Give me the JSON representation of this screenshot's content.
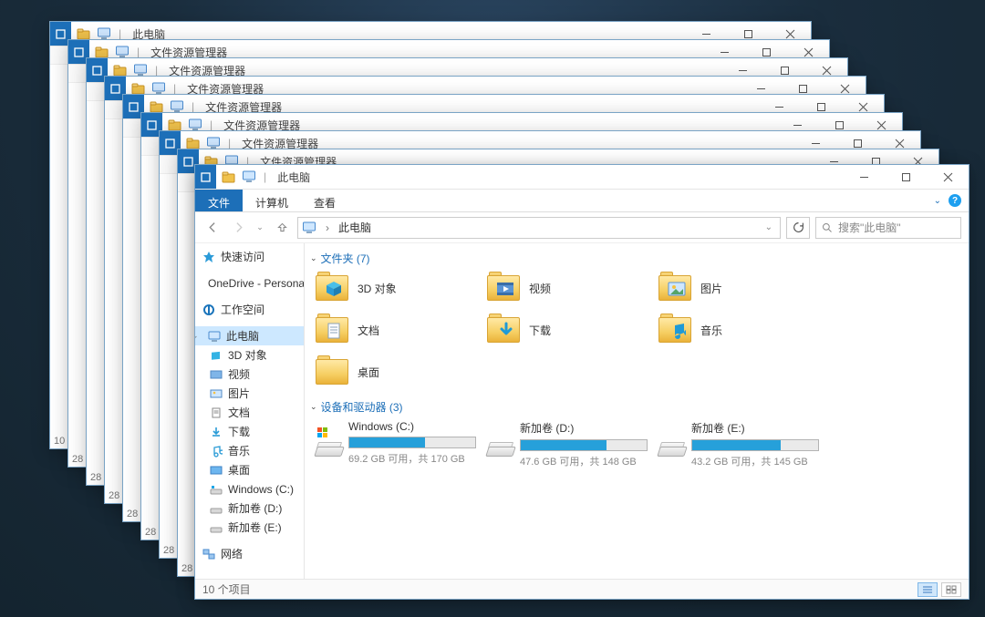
{
  "back_windows": [
    {
      "title": "此电脑",
      "hint": "10"
    },
    {
      "title": "文件资源管理器",
      "hint": "28"
    },
    {
      "title": "文件资源管理器",
      "hint": "28"
    },
    {
      "title": "文件资源管理器",
      "hint": "28"
    },
    {
      "title": "文件资源管理器",
      "hint": "28"
    },
    {
      "title": "文件资源管理器",
      "hint": "28"
    },
    {
      "title": "文件资源管理器",
      "hint": "28"
    },
    {
      "title": "文件资源管理器",
      "hint": "28"
    },
    {
      "title": "此电脑",
      "hint": ""
    }
  ],
  "main": {
    "title": "此电脑",
    "ribbon": {
      "file": "文件",
      "tabs": [
        "计算机",
        "查看"
      ]
    },
    "address": "此电脑",
    "search_placeholder": "搜索\"此电脑\"",
    "nav": {
      "quick": "快速访问",
      "onedrive": "OneDrive - Persona",
      "workspace": "工作空间",
      "this_pc": "此电脑",
      "children": [
        "3D 对象",
        "视频",
        "图片",
        "文档",
        "下载",
        "音乐",
        "桌面",
        "Windows (C:)",
        "新加卷 (D:)",
        "新加卷 (E:)"
      ],
      "network": "网络"
    },
    "groups": {
      "folders_hdr": "文件夹 (7)",
      "devices_hdr": "设备和驱动器 (3)"
    },
    "folders": [
      {
        "label": "3D 对象",
        "badge": "cube"
      },
      {
        "label": "视频",
        "badge": "video"
      },
      {
        "label": "图片",
        "badge": "photo"
      },
      {
        "label": "文档",
        "badge": "doc"
      },
      {
        "label": "下载",
        "badge": "download"
      },
      {
        "label": "音乐",
        "badge": "music"
      },
      {
        "label": "桌面",
        "badge": "plain"
      }
    ],
    "drives": [
      {
        "name": "Windows (C:)",
        "fill_pct": 60,
        "sub": "69.2 GB 可用，共 170 GB",
        "os": true
      },
      {
        "name": "新加卷 (D:)",
        "fill_pct": 68,
        "sub": "47.6 GB 可用，共 148 GB",
        "os": false
      },
      {
        "name": "新加卷 (E:)",
        "fill_pct": 70,
        "sub": "43.2 GB 可用，共 145 GB",
        "os": false
      }
    ],
    "status": "10 个项目"
  },
  "icons": {
    "folder_color": "#f0c24c",
    "accent": "#1d6fb8"
  }
}
